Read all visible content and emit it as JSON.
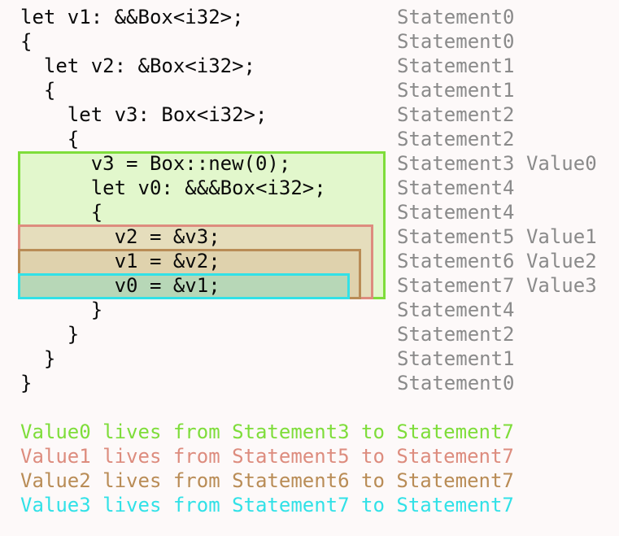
{
  "colors": {
    "background": "#fdf9f9",
    "code_text": "#0a0a0a",
    "annotation_text": "#8a8a8a",
    "value0": "#7edd3a",
    "value1": "#dd8c7e",
    "value2": "#b98c56",
    "value3": "#31e1e7"
  },
  "code_lines": [
    "let v1: &&Box<i32>;",
    "{",
    "  let v2: &Box<i32>;",
    "  {",
    "    let v3: Box<i32>;",
    "    {",
    "      v3 = Box::new(0);",
    "      let v0: &&&Box<i32>;",
    "      {",
    "        v2 = &v3;",
    "        v1 = &v2;",
    "        v0 = &v1;",
    "      }",
    "    }",
    "  }",
    "}"
  ],
  "annotations": [
    "Statement0",
    "Statement0",
    "Statement1",
    "Statement1",
    "Statement2",
    "Statement2",
    "Statement3 Value0",
    "Statement4",
    "Statement4",
    "Statement5 Value1",
    "Statement6 Value2",
    "Statement7 Value3",
    "Statement4",
    "Statement2",
    "Statement1",
    "Statement0"
  ],
  "legend": [
    "Value0 lives from Statement3 to Statement7",
    "Value1 lives from Statement5 to Statement7",
    "Value2 lives from Statement6 to Statement7",
    "Value3 lives from Statement7 to Statement7"
  ]
}
